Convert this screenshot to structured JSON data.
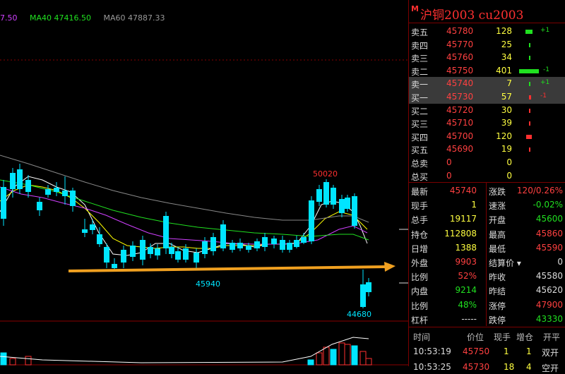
{
  "legend": {
    "ma_prev": "7.50",
    "ma40": "MA40 47416.50",
    "ma60": "MA60 47887.33"
  },
  "chart": {
    "high_label": "50020",
    "low_label_1": "45940",
    "low_label_2": "44680",
    "colors": {
      "up": "#ff3030",
      "down": "#00e5ff",
      "ma5": "#ffffff",
      "ma10": "#ffff00",
      "ma20": "#d040ff",
      "ma40": "#20e020",
      "ma60": "#888888",
      "arrow": "#f0a020"
    }
  },
  "panel": {
    "title_mark": "M",
    "title": "沪铜2003  cu2003",
    "orderbook": [
      {
        "label": "卖五",
        "price": "45780",
        "vol": "128",
        "chg": "+1",
        "bar": 0.35,
        "color": "#20e020"
      },
      {
        "label": "卖四",
        "price": "45770",
        "vol": "25",
        "chg": "",
        "bar": 0.05,
        "color": "#20e020"
      },
      {
        "label": "卖三",
        "price": "45760",
        "vol": "34",
        "chg": "",
        "bar": 0.05,
        "color": "#20e020"
      },
      {
        "label": "卖二",
        "price": "45750",
        "vol": "401",
        "chg": "-1",
        "bar": 1.0,
        "color": "#20e020"
      },
      {
        "label": "卖一",
        "price": "45740",
        "vol": "7",
        "chg": "+1",
        "bar": 0.02,
        "color": "#20e020"
      },
      {
        "label": "买一",
        "price": "45730",
        "vol": "57",
        "chg": "-1",
        "bar": 0.1,
        "color": "#ff3030"
      },
      {
        "label": "买二",
        "price": "45720",
        "vol": "30",
        "chg": "",
        "bar": 0.05,
        "color": "#ff3030"
      },
      {
        "label": "买三",
        "price": "45710",
        "vol": "39",
        "chg": "",
        "bar": 0.05,
        "color": "#ff3030"
      },
      {
        "label": "买四",
        "price": "45700",
        "vol": "120",
        "chg": "",
        "bar": 0.3,
        "color": "#ff3030"
      },
      {
        "label": "买五",
        "price": "45690",
        "vol": "19",
        "chg": "",
        "bar": 0.05,
        "color": "#ff3030"
      },
      {
        "label": "总卖",
        "price": "0",
        "vol": "0",
        "chg": "",
        "bar": 0,
        "color": "#ff3030"
      },
      {
        "label": "总买",
        "price": "0",
        "vol": "0",
        "chg": "",
        "bar": 0,
        "color": "#ff3030"
      }
    ],
    "stats": [
      {
        "l1": "最新",
        "v1": "45740",
        "c1": "red",
        "l2": "涨跌",
        "v2": "120/0.26%",
        "c2": "red"
      },
      {
        "l1": "现手",
        "v1": "1",
        "c1": "yel",
        "l2": "速涨",
        "v2": "-0.02%",
        "c2": "grn"
      },
      {
        "l1": "总手",
        "v1": "19117",
        "c1": "yel",
        "l2": "开盘",
        "v2": "45600",
        "c2": "grn"
      },
      {
        "l1": "持仓",
        "v1": "112808",
        "c1": "yel",
        "l2": "最高",
        "v2": "45860",
        "c2": "red"
      },
      {
        "l1": "日增",
        "v1": "1388",
        "c1": "yel",
        "l2": "最低",
        "v2": "45590",
        "c2": "red"
      },
      {
        "l1": "外盘",
        "v1": "9903",
        "c1": "red",
        "l2": "结算价 ▾",
        "v2": "0",
        "c2": "wht"
      },
      {
        "l1": "比例",
        "v1": "52%",
        "c1": "red",
        "l2": "昨收",
        "v2": "45580",
        "c2": "wht"
      },
      {
        "l1": "内盘",
        "v1": "9214",
        "c1": "grn",
        "l2": "昨结",
        "v2": "45620",
        "c2": "wht"
      },
      {
        "l1": "比例",
        "v1": "48%",
        "c1": "grn",
        "l2": "涨停",
        "v2": "47900",
        "c2": "red"
      },
      {
        "l1": "杠杆",
        "v1": "-----",
        "c1": "wht",
        "l2": "跌停",
        "v2": "43330",
        "c2": "grn"
      }
    ],
    "trades_header": {
      "time": "时间",
      "price": "价位",
      "qty": "现手",
      "inc": "增仓",
      "type": "开平"
    },
    "trades": [
      {
        "time": "10:53:19",
        "price": "45750",
        "qty": "1",
        "inc": "1",
        "type": "双开"
      },
      {
        "time": "10:53:25",
        "price": "45730",
        "qty": "18",
        "inc": "4",
        "type": "空开"
      }
    ]
  }
}
